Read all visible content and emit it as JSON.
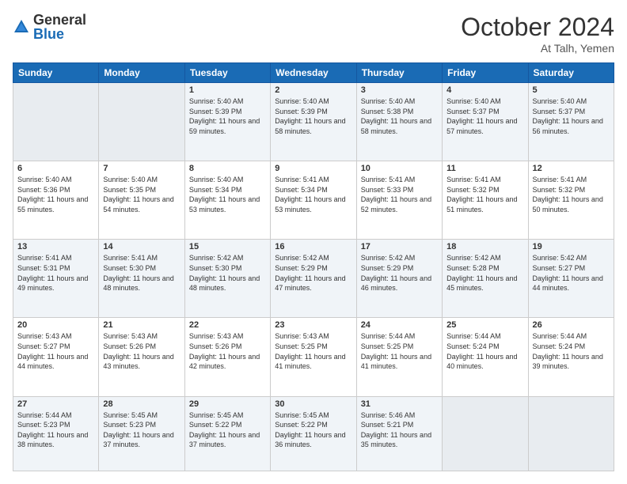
{
  "logo": {
    "general": "General",
    "blue": "Blue"
  },
  "title": "October 2024",
  "location": "At Talh, Yemen",
  "weekdays": [
    "Sunday",
    "Monday",
    "Tuesday",
    "Wednesday",
    "Thursday",
    "Friday",
    "Saturday"
  ],
  "weeks": [
    [
      {
        "day": "",
        "empty": true
      },
      {
        "day": "",
        "empty": true
      },
      {
        "day": "1",
        "sunrise": "5:40 AM",
        "sunset": "5:39 PM",
        "daylight": "11 hours and 59 minutes."
      },
      {
        "day": "2",
        "sunrise": "5:40 AM",
        "sunset": "5:39 PM",
        "daylight": "11 hours and 58 minutes."
      },
      {
        "day": "3",
        "sunrise": "5:40 AM",
        "sunset": "5:38 PM",
        "daylight": "11 hours and 58 minutes."
      },
      {
        "day": "4",
        "sunrise": "5:40 AM",
        "sunset": "5:37 PM",
        "daylight": "11 hours and 57 minutes."
      },
      {
        "day": "5",
        "sunrise": "5:40 AM",
        "sunset": "5:37 PM",
        "daylight": "11 hours and 56 minutes."
      }
    ],
    [
      {
        "day": "6",
        "sunrise": "5:40 AM",
        "sunset": "5:36 PM",
        "daylight": "11 hours and 55 minutes."
      },
      {
        "day": "7",
        "sunrise": "5:40 AM",
        "sunset": "5:35 PM",
        "daylight": "11 hours and 54 minutes."
      },
      {
        "day": "8",
        "sunrise": "5:40 AM",
        "sunset": "5:34 PM",
        "daylight": "11 hours and 53 minutes."
      },
      {
        "day": "9",
        "sunrise": "5:41 AM",
        "sunset": "5:34 PM",
        "daylight": "11 hours and 53 minutes."
      },
      {
        "day": "10",
        "sunrise": "5:41 AM",
        "sunset": "5:33 PM",
        "daylight": "11 hours and 52 minutes."
      },
      {
        "day": "11",
        "sunrise": "5:41 AM",
        "sunset": "5:32 PM",
        "daylight": "11 hours and 51 minutes."
      },
      {
        "day": "12",
        "sunrise": "5:41 AM",
        "sunset": "5:32 PM",
        "daylight": "11 hours and 50 minutes."
      }
    ],
    [
      {
        "day": "13",
        "sunrise": "5:41 AM",
        "sunset": "5:31 PM",
        "daylight": "11 hours and 49 minutes."
      },
      {
        "day": "14",
        "sunrise": "5:41 AM",
        "sunset": "5:30 PM",
        "daylight": "11 hours and 48 minutes."
      },
      {
        "day": "15",
        "sunrise": "5:42 AM",
        "sunset": "5:30 PM",
        "daylight": "11 hours and 48 minutes."
      },
      {
        "day": "16",
        "sunrise": "5:42 AM",
        "sunset": "5:29 PM",
        "daylight": "11 hours and 47 minutes."
      },
      {
        "day": "17",
        "sunrise": "5:42 AM",
        "sunset": "5:29 PM",
        "daylight": "11 hours and 46 minutes."
      },
      {
        "day": "18",
        "sunrise": "5:42 AM",
        "sunset": "5:28 PM",
        "daylight": "11 hours and 45 minutes."
      },
      {
        "day": "19",
        "sunrise": "5:42 AM",
        "sunset": "5:27 PM",
        "daylight": "11 hours and 44 minutes."
      }
    ],
    [
      {
        "day": "20",
        "sunrise": "5:43 AM",
        "sunset": "5:27 PM",
        "daylight": "11 hours and 44 minutes."
      },
      {
        "day": "21",
        "sunrise": "5:43 AM",
        "sunset": "5:26 PM",
        "daylight": "11 hours and 43 minutes."
      },
      {
        "day": "22",
        "sunrise": "5:43 AM",
        "sunset": "5:26 PM",
        "daylight": "11 hours and 42 minutes."
      },
      {
        "day": "23",
        "sunrise": "5:43 AM",
        "sunset": "5:25 PM",
        "daylight": "11 hours and 41 minutes."
      },
      {
        "day": "24",
        "sunrise": "5:44 AM",
        "sunset": "5:25 PM",
        "daylight": "11 hours and 41 minutes."
      },
      {
        "day": "25",
        "sunrise": "5:44 AM",
        "sunset": "5:24 PM",
        "daylight": "11 hours and 40 minutes."
      },
      {
        "day": "26",
        "sunrise": "5:44 AM",
        "sunset": "5:24 PM",
        "daylight": "11 hours and 39 minutes."
      }
    ],
    [
      {
        "day": "27",
        "sunrise": "5:44 AM",
        "sunset": "5:23 PM",
        "daylight": "11 hours and 38 minutes."
      },
      {
        "day": "28",
        "sunrise": "5:45 AM",
        "sunset": "5:23 PM",
        "daylight": "11 hours and 37 minutes."
      },
      {
        "day": "29",
        "sunrise": "5:45 AM",
        "sunset": "5:22 PM",
        "daylight": "11 hours and 37 minutes."
      },
      {
        "day": "30",
        "sunrise": "5:45 AM",
        "sunset": "5:22 PM",
        "daylight": "11 hours and 36 minutes."
      },
      {
        "day": "31",
        "sunrise": "5:46 AM",
        "sunset": "5:21 PM",
        "daylight": "11 hours and 35 minutes."
      },
      {
        "day": "",
        "empty": true
      },
      {
        "day": "",
        "empty": true
      }
    ]
  ]
}
